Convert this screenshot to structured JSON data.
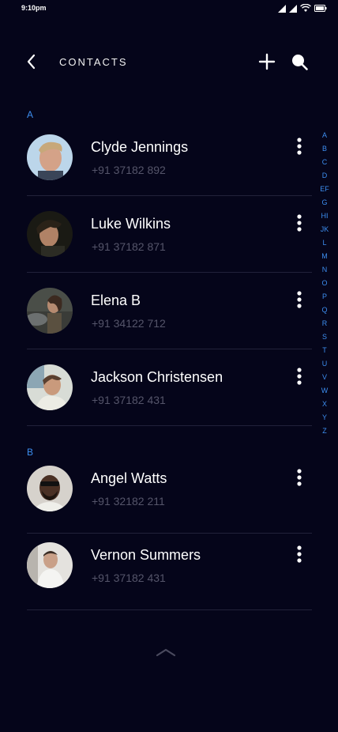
{
  "status_bar": {
    "time": "9:10pm"
  },
  "header": {
    "title": "CONTACTS",
    "back_icon": "chevron-left-icon",
    "add_icon": "plus-icon",
    "search_icon": "search-icon"
  },
  "sections": [
    {
      "letter": "A",
      "contacts": [
        {
          "name": "Clyde Jennings",
          "phone": "+91 37182 892"
        },
        {
          "name": "Luke Wilkins",
          "phone": "+91 37182 871"
        },
        {
          "name": "Elena B",
          "phone": "+91 34122 712"
        },
        {
          "name": "Jackson Christensen",
          "phone": "+91 37182 431"
        }
      ]
    },
    {
      "letter": "B",
      "contacts": [
        {
          "name": "Angel Watts",
          "phone": "+91 32182 211"
        },
        {
          "name": "Vernon Summers",
          "phone": "+91 37182 431"
        }
      ]
    }
  ],
  "alphabet_index": [
    "A",
    "B",
    "C",
    "D",
    "EF",
    "G",
    "HI",
    "JK",
    "L",
    "M",
    "N",
    "O",
    "P",
    "Q",
    "R",
    "S",
    "T",
    "U",
    "V",
    "W",
    "X",
    "Y",
    "Z"
  ],
  "colors": {
    "background": "#05051a",
    "accent": "#3d8ef0",
    "phone_text": "#55556a",
    "divider": "#22223a"
  }
}
